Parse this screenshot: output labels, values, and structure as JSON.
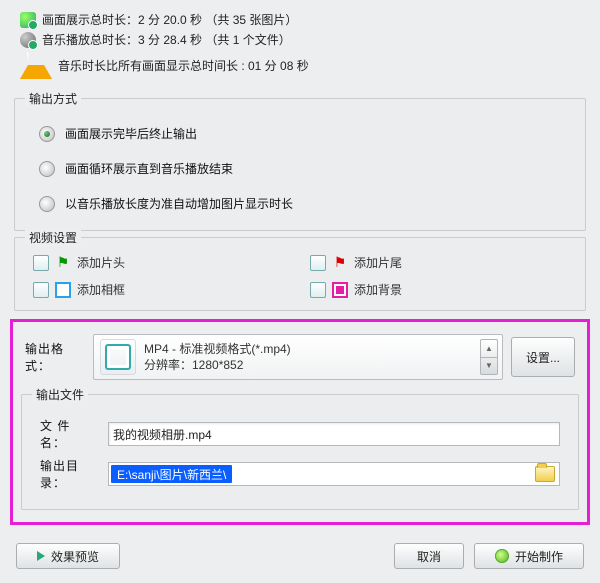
{
  "info": {
    "display_total": "画面展示总时长：2 分 20.0 秒 （共 35 张图片）",
    "music_total": "音乐播放总时长：3 分 28.4 秒 （共 1 个文件）",
    "warn": "音乐时长比所有画面显示总时间长 : 01 分 08 秒"
  },
  "output_mode": {
    "legend": "输出方式",
    "options": [
      "画面展示完毕后终止输出",
      "画面循环展示直到音乐播放结束",
      "以音乐播放长度为准自动增加图片显示时长"
    ],
    "selected": 0
  },
  "video_settings": {
    "legend": "视频设置",
    "items": {
      "head": "添加片头",
      "tail": "添加片尾",
      "frame": "添加相框",
      "bg": "添加背景"
    }
  },
  "format": {
    "label": "输出格式：",
    "line1": "MP4 - 标准视频格式(*.mp4)",
    "line2": "分辨率：1280*852",
    "settings_btn": "设置..."
  },
  "output_file": {
    "legend": "输出文件",
    "name_label": "文 件 名：",
    "name_value": "我的视频相册.mp4",
    "dir_label": "输出目录：",
    "dir_value": "E:\\sanji\\图片\\新西兰\\"
  },
  "buttons": {
    "preview": "效果预览",
    "cancel": "取消",
    "start": "开始制作"
  }
}
